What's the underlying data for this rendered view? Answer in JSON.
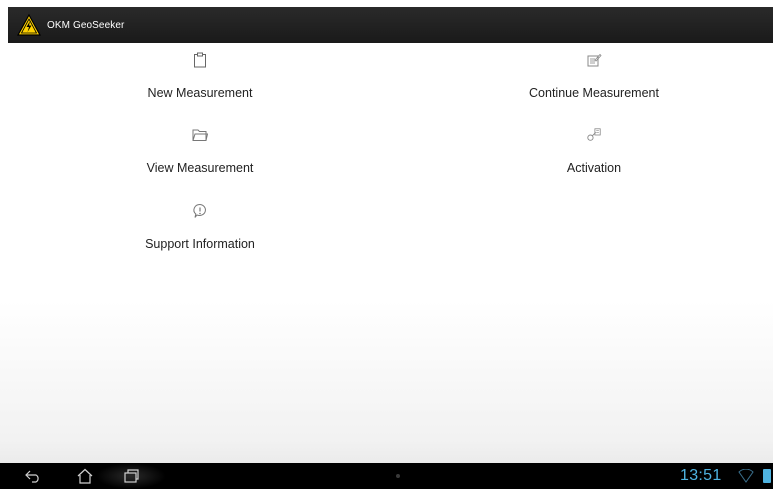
{
  "app": {
    "title": "OKM GeoSeeker",
    "icon": "warning-triangle-icon",
    "colors": {
      "bar": "#1f1f1f",
      "warning_yellow": "#ffd200",
      "accent": "#4fb3e0"
    }
  },
  "menu": {
    "new_measurement": {
      "label": "New Measurement",
      "icon": "clipboard-icon"
    },
    "continue_measurement": {
      "label": "Continue Measurement",
      "icon": "edit-document-icon"
    },
    "view_measurement": {
      "label": "View Measurement",
      "icon": "folder-icon"
    },
    "activation": {
      "label": "Activation",
      "icon": "key-icon"
    },
    "support_information": {
      "label": "Support Information",
      "icon": "info-bubble-icon"
    }
  },
  "status": {
    "time": "13:51"
  }
}
